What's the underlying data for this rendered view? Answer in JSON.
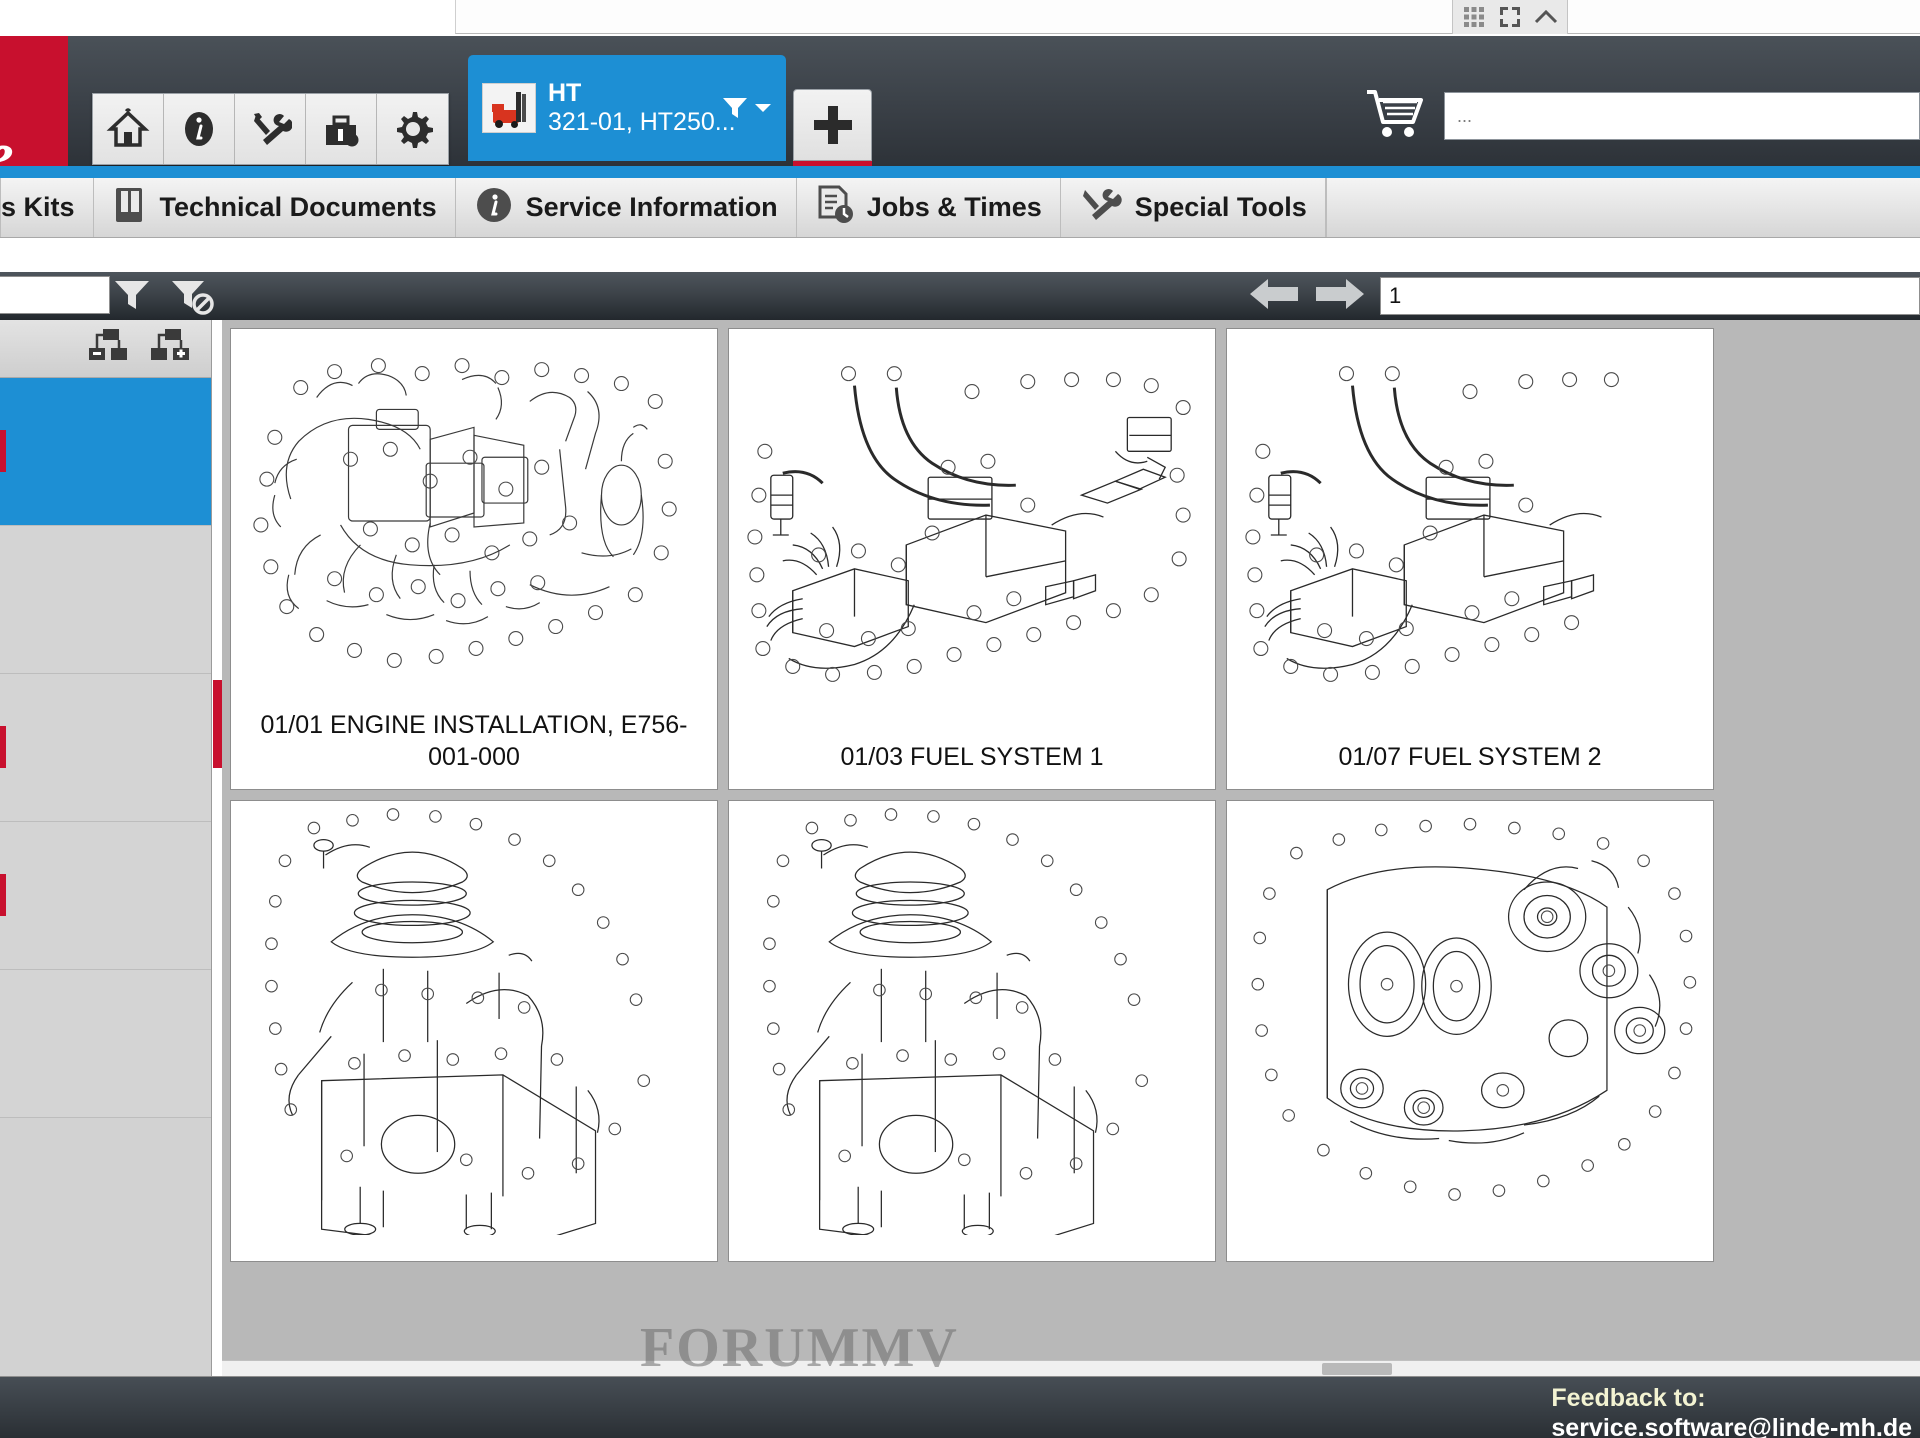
{
  "window": {
    "controls": [
      {
        "name": "grid-view-icon",
        "glyph": "grid"
      },
      {
        "name": "fullscreen-icon",
        "glyph": "expand"
      },
      {
        "name": "collapse-up-icon",
        "glyph": "chevron-up"
      }
    ]
  },
  "brand": {
    "text": "de",
    "color": "#c8102e"
  },
  "header": {
    "icon_buttons": [
      {
        "name": "home-icon",
        "label": "Home"
      },
      {
        "name": "info-icon",
        "label": "Information"
      },
      {
        "name": "tools-icon",
        "label": "Tools"
      },
      {
        "name": "toolbox-icon",
        "label": "Toolbox"
      },
      {
        "name": "gear-icon",
        "label": "Settings"
      }
    ],
    "vehicle_tab": {
      "title": "HT",
      "subtitle": "321-01,  HT250...",
      "dropdown_icon": "filter-caret"
    },
    "add_tab_label": "+",
    "cart_icon": "shopping-cart-icon",
    "search_placeholder": "..."
  },
  "menubar": {
    "items": [
      {
        "name": "menu-item-kits",
        "label": "s Kits",
        "icon": "kits-icon",
        "truncated": true
      },
      {
        "name": "menu-item-technical-documents",
        "label": "Technical Documents",
        "icon": "book-icon"
      },
      {
        "name": "menu-item-service-information",
        "label": "Service Information",
        "icon": "info-circle-icon"
      },
      {
        "name": "menu-item-jobs-and-times",
        "label": "Jobs & Times",
        "icon": "document-clock-icon"
      },
      {
        "name": "menu-item-special-tools",
        "label": "Special Tools",
        "icon": "wrench-screwdriver-icon"
      }
    ]
  },
  "toolbar": {
    "search_value": "",
    "filter_icon": "funnel-icon",
    "clear_filter_icon": "funnel-clear-icon",
    "prev_icon": "arrow-left-icon",
    "next_icon": "arrow-right-icon",
    "page_value": "1"
  },
  "tree": {
    "expand_all_icon": "expand-tree-icon",
    "collapse_all_icon": "collapse-tree-icon",
    "rows": [
      {
        "name": "tree-row-1",
        "label": "",
        "selected": true
      },
      {
        "name": "tree-row-2",
        "label": "",
        "selected": false
      },
      {
        "name": "tree-row-3",
        "label": "",
        "selected": false
      },
      {
        "name": "tree-row-4",
        "label": "",
        "selected": false
      },
      {
        "name": "tree-row-5",
        "label": "",
        "selected": false
      }
    ]
  },
  "content": {
    "cards": [
      {
        "name": "card-engine-installation",
        "caption": "01/01 ENGINE INSTALLATION, E756-001-000",
        "diagram": "engine-installation"
      },
      {
        "name": "card-fuel-system-1",
        "caption": "01/03 FUEL SYSTEM 1",
        "diagram": "fuel-system"
      },
      {
        "name": "card-fuel-system-2",
        "caption": "01/07 FUEL SYSTEM 2",
        "diagram": "fuel-system"
      },
      {
        "name": "card-cylinder-head-1",
        "caption": "",
        "diagram": "cylinder-head"
      },
      {
        "name": "card-cylinder-head-2",
        "caption": "",
        "diagram": "cylinder-head"
      },
      {
        "name": "card-timing-case",
        "caption": "",
        "diagram": "timing-case"
      }
    ]
  },
  "footer": {
    "feedback_title": "Feedback to:",
    "feedback_email": "service.software@linde-mh.de",
    "watermark": "FORUMMV"
  }
}
